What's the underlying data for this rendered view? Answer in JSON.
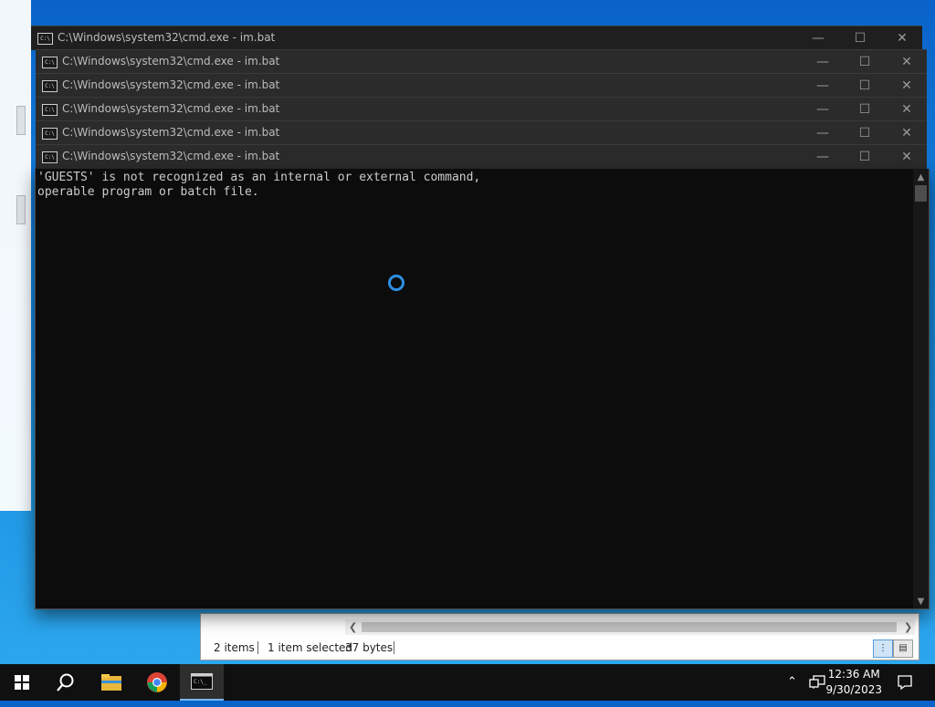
{
  "windows": [
    {
      "title": "C:\\Windows\\system32\\cmd.exe - im.bat"
    },
    {
      "title": "C:\\Windows\\system32\\cmd.exe - im.bat"
    },
    {
      "title": "C:\\Windows\\system32\\cmd.exe - im.bat"
    },
    {
      "title": "C:\\Windows\\system32\\cmd.exe - im.bat"
    },
    {
      "title": "C:\\Windows\\system32\\cmd.exe - im.bat"
    },
    {
      "title": "C:\\Windows\\system32\\cmd.exe - im.bat"
    }
  ],
  "console": {
    "line1": "'GUESTS' is not recognized as an internal or external command,",
    "line2": "operable program or batch file."
  },
  "explorer": {
    "item_count": "2 items",
    "selected": "1 item selected",
    "size": "37 bytes"
  },
  "taskbar": {
    "time": "12:36 AM",
    "date": "9/30/2023",
    "icons": [
      "windows-start-icon",
      "search-icon",
      "file-explorer-icon",
      "chrome-icon",
      "cmd-icon"
    ]
  },
  "colors": {
    "desktop": "#1a8fe0",
    "console_bg": "#0c0c0c",
    "console_text": "#cccccc",
    "spinner": "#2d8fe3",
    "taskbar": "#101010"
  }
}
